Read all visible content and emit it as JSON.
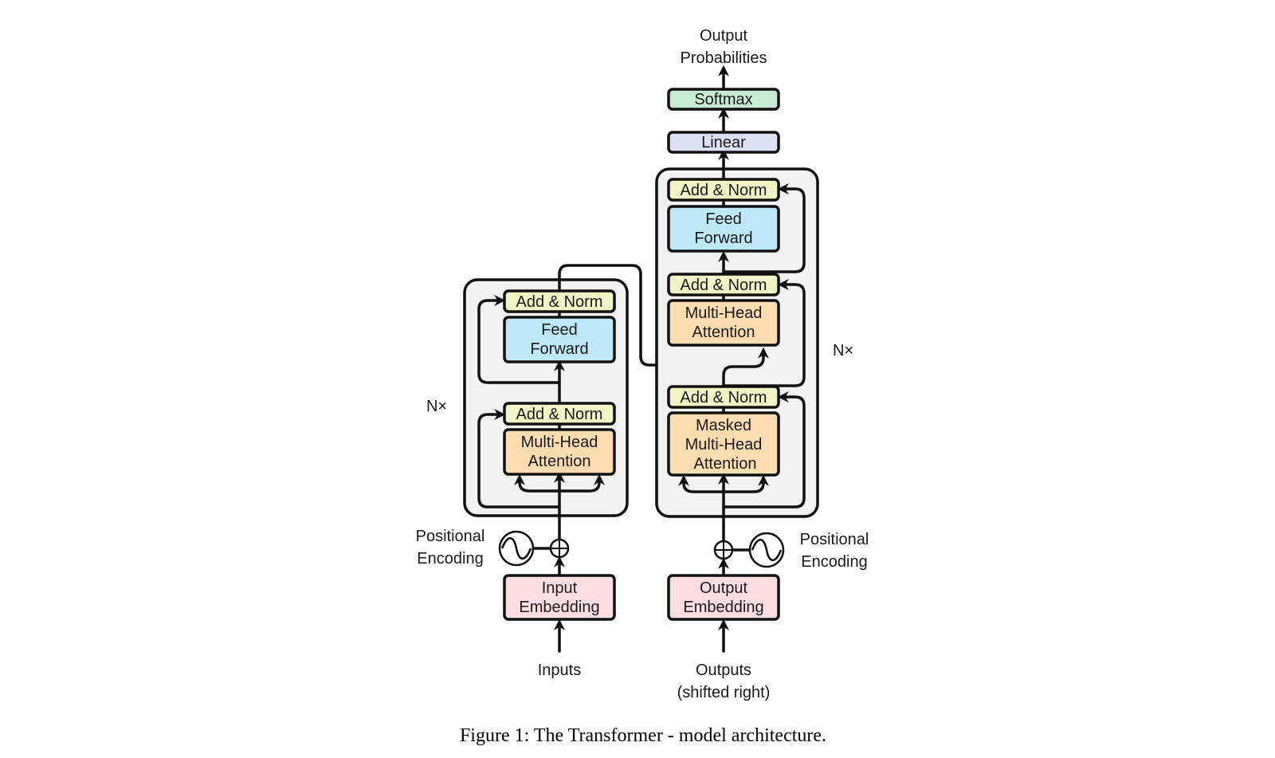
{
  "colors": {
    "add_norm": "#f1f4c4",
    "feed_forward": "#bde8f7",
    "attention": "#fddcaf",
    "embedding": "#fcdde2",
    "linear": "#dcdff5",
    "softmax": "#c8ecd3",
    "stack_bg": "#f2f2f2"
  },
  "encoder": {
    "repeat_label": "N×",
    "add_norm_top": "Add & Norm",
    "feed_forward": [
      "Feed",
      "Forward"
    ],
    "add_norm_bottom": "Add & Norm",
    "attention": [
      "Multi-Head",
      "Attention"
    ],
    "positional_encoding": [
      "Positional",
      "Encoding"
    ],
    "embedding": [
      "Input",
      "Embedding"
    ],
    "input_label": "Inputs"
  },
  "decoder": {
    "repeat_label": "N×",
    "add_norm_top": "Add & Norm",
    "feed_forward": [
      "Feed",
      "Forward"
    ],
    "add_norm_mid": "Add & Norm",
    "cross_attention": [
      "Multi-Head",
      "Attention"
    ],
    "add_norm_bottom": "Add & Norm",
    "masked_attention": [
      "Masked",
      "Multi-Head",
      "Attention"
    ],
    "positional_encoding": [
      "Positional",
      "Encoding"
    ],
    "embedding": [
      "Output",
      "Embedding"
    ],
    "input_label": [
      "Outputs",
      "(shifted right)"
    ]
  },
  "head": {
    "linear": "Linear",
    "softmax": "Softmax",
    "output_label": [
      "Output",
      "Probabilities"
    ]
  },
  "caption": "Figure 1: The Transformer - model architecture."
}
